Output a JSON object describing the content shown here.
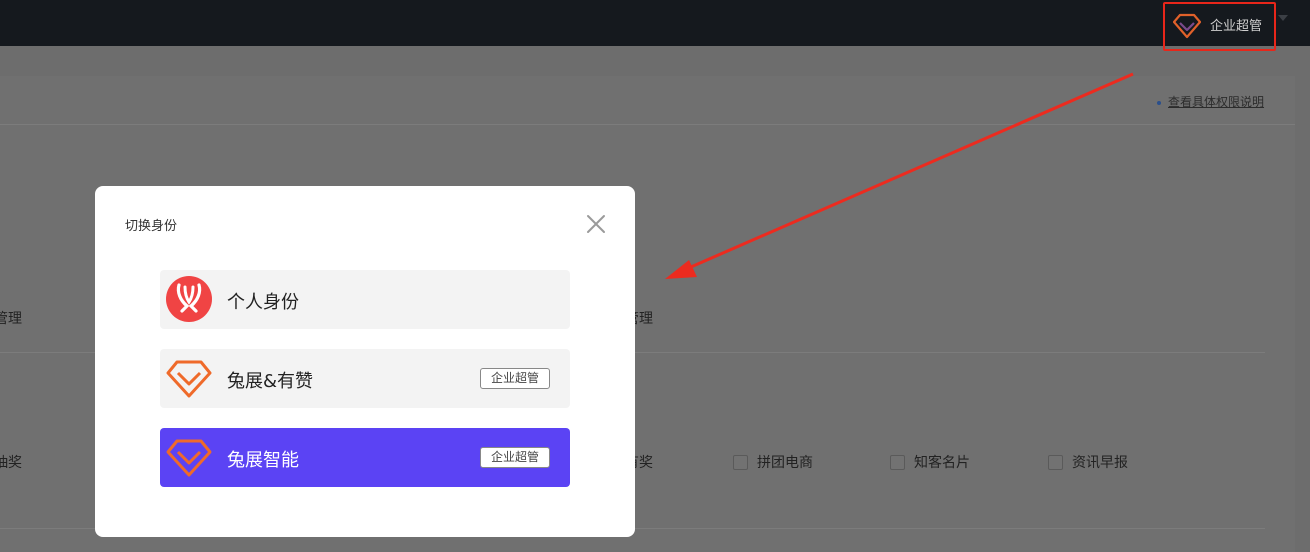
{
  "topbar": {
    "role_label": "企业超管",
    "role_icon": "diamond-logo-icon",
    "accent_color": "#e8261a"
  },
  "page": {
    "permission_link": "查看具体权限说明",
    "row1_left": "管理",
    "row1_right": "管理",
    "row2_left": "抽奖",
    "row2_right": "有奖",
    "checkboxes": [
      "拼团电商",
      "知客名片",
      "资讯早报"
    ]
  },
  "modal": {
    "title": "切换身份",
    "options": [
      {
        "name": "个人身份",
        "icon": "rabbit-avatar-icon",
        "tag": ""
      },
      {
        "name": "兔展&有赞",
        "icon": "diamond-logo-icon",
        "tag": "企业超管"
      },
      {
        "name": "兔展智能",
        "icon": "diamond-logo-icon",
        "tag": "企业超管",
        "selected": true
      }
    ],
    "selected_color": "#5b43f4"
  }
}
